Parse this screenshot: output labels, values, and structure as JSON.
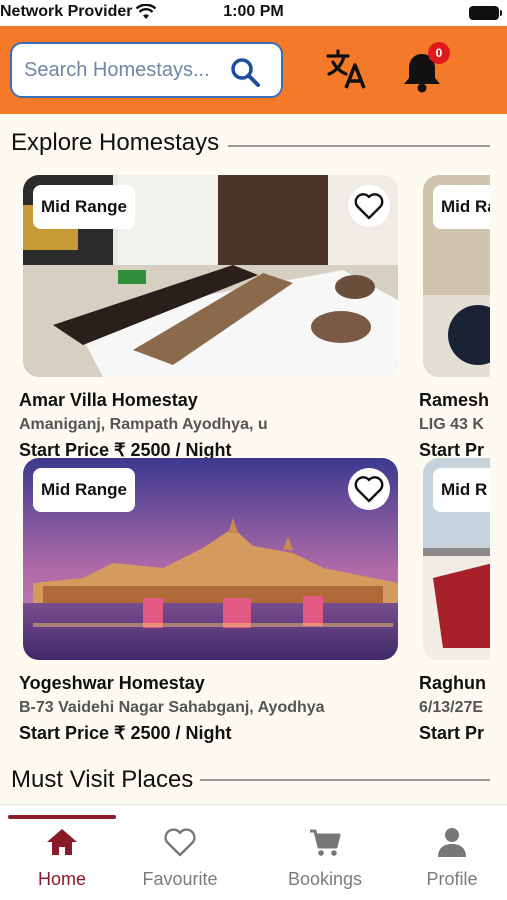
{
  "status_bar": {
    "carrier": "Network Provider",
    "time": "1:00 PM"
  },
  "header": {
    "search_placeholder": "Search Homestays...",
    "notification_count": "0",
    "colors": {
      "header_bg": "#f47a2a",
      "accent": "#8a1a2a"
    }
  },
  "sections": {
    "explore_title": "Explore Homestays",
    "places_title": "Must Visit Places"
  },
  "homestays": [
    {
      "badge": "Mid Range",
      "name": "Amar Villa Homestay",
      "address": "Amaniganj, Rampath Ayodhya, u",
      "price": "Start Price ₹ 2500 / Night",
      "image": "bedroom-photo"
    },
    {
      "badge": "Mid Range",
      "name": "Ramesh",
      "address": "LIG 43 K",
      "price": "Start Pr",
      "image": "bedroom-photo"
    },
    {
      "badge": "Mid Range",
      "name": "Yogeshwar Homestay",
      "address": "B-73 Vaidehi Nagar Sahabganj, Ayodhya",
      "price": "Start Price ₹ 2500 / Night",
      "image": "ayodhya-ghat-photo"
    },
    {
      "badge": "Mid R",
      "name": "Raghun",
      "address": "6/13/27E",
      "price": "Start Pr",
      "image": "building-photo"
    }
  ],
  "bottom_nav": [
    {
      "label": "Home",
      "icon": "home-icon",
      "active": true
    },
    {
      "label": "Favourite",
      "icon": "heart-icon",
      "active": false
    },
    {
      "label": "Bookings",
      "icon": "cart-icon",
      "active": false
    },
    {
      "label": "Profile",
      "icon": "person-icon",
      "active": false
    }
  ]
}
